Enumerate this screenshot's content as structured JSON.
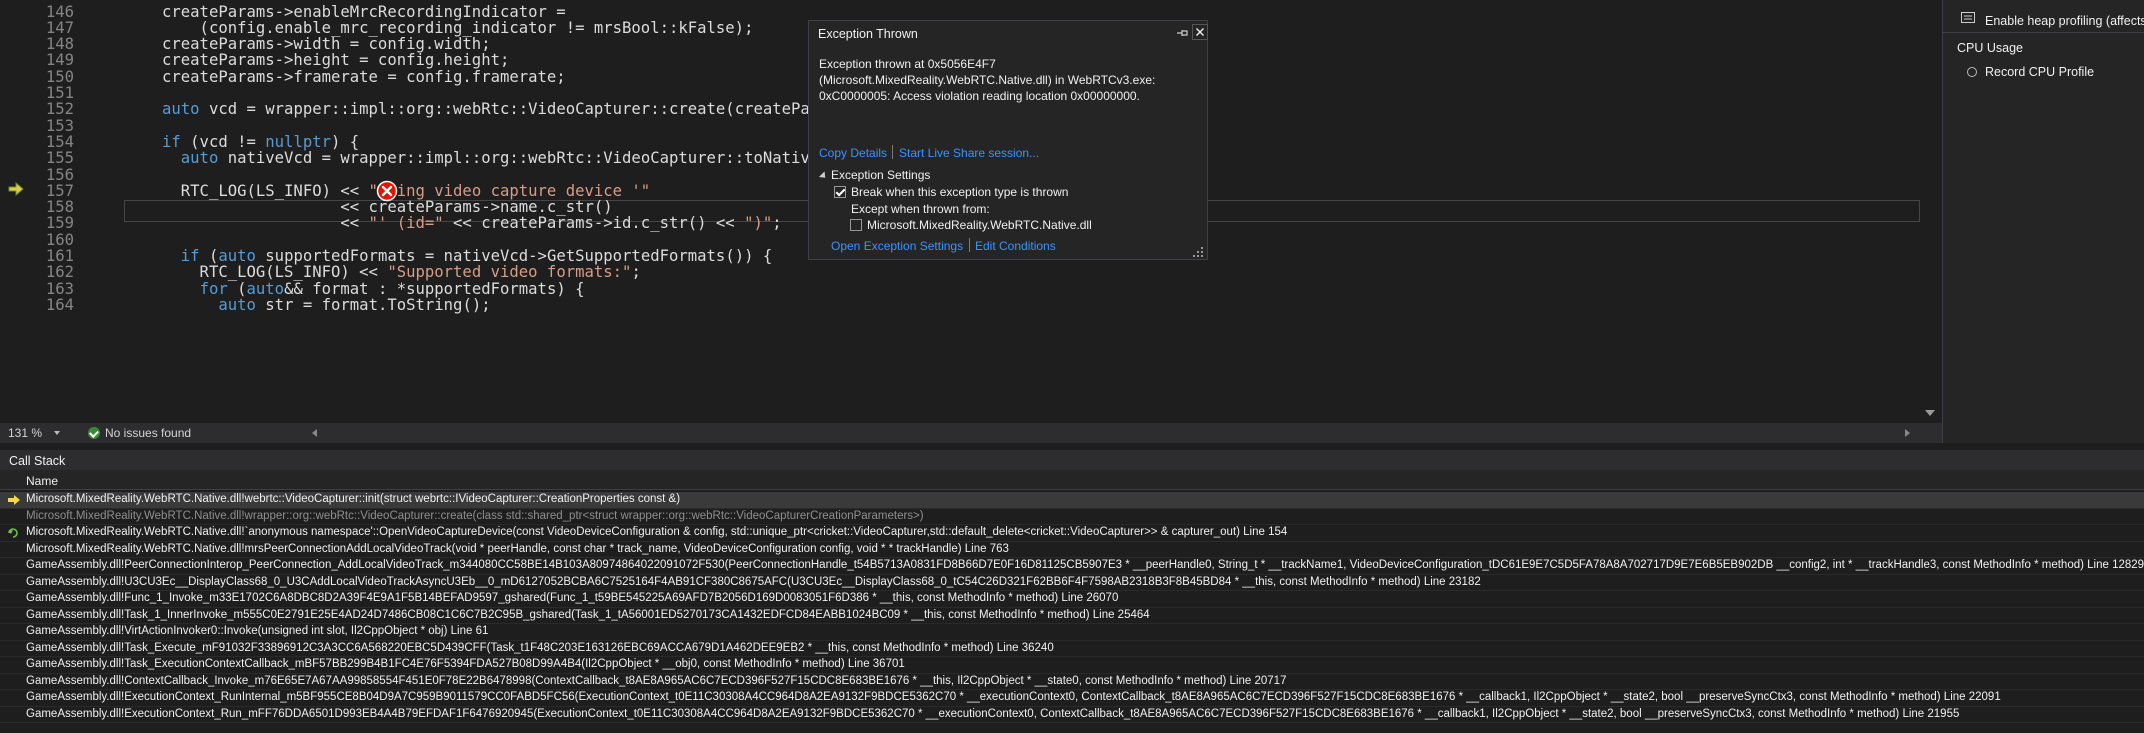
{
  "editor": {
    "lines": [
      {
        "num": "146",
        "code": "createParams->enableMrcRecordingIndicator ="
      },
      {
        "num": "147",
        "code": "    (config.enable_mrc_recording_indicator != mrsBool::kFalse);"
      },
      {
        "num": "148",
        "code": "createParams->width = config.width;"
      },
      {
        "num": "149",
        "code": "createParams->height = config.height;"
      },
      {
        "num": "150",
        "code": "createParams->framerate = config.framerate;"
      },
      {
        "num": "151",
        "code": ""
      },
      {
        "num": "152",
        "code": "auto vcd = wrapper::impl::org::webRtc::VideoCapturer::create(createPa"
      },
      {
        "num": "153",
        "code": ""
      },
      {
        "num": "154",
        "code": "if (vcd != nullptr) {"
      },
      {
        "num": "155",
        "code": "  auto nativeVcd = wrapper::impl::org::webRtc::VideoCapturer::toNativ"
      },
      {
        "num": "156",
        "code": ""
      },
      {
        "num": "157",
        "code": "  RTC_LOG(LS_INFO) << \"Using video capture device '\""
      },
      {
        "num": "158",
        "code": "                   << createParams->name.c_str()"
      },
      {
        "num": "159",
        "code": "                   << \"' (id=\" << createParams->id.c_str() << \")\";"
      },
      {
        "num": "160",
        "code": ""
      },
      {
        "num": "161",
        "code": "  if (auto supportedFormats = nativeVcd->GetSupportedFormats()) {"
      },
      {
        "num": "162",
        "code": "    RTC_LOG(LS_INFO) << \"Supported video formats:\";"
      },
      {
        "num": "163",
        "code": "    for (auto&& format : *supportedFormats) {"
      },
      {
        "num": "164",
        "code": "      auto str = format.ToString();"
      }
    ],
    "zoom": "131 %",
    "issues": "No issues found"
  },
  "exception": {
    "title": "Exception Thrown",
    "message": "Exception thrown at 0x5056E4F7\n(Microsoft.MixedReality.WebRTC.Native.dll) in WebRTCv3.exe:\n0xC0000005: Access violation reading location 0x00000000.",
    "copy_details": "Copy Details",
    "live_share": "Start Live Share session...",
    "settings_header": "Exception Settings",
    "break_label": "Break when this exception type is thrown",
    "break_checked": true,
    "except_label": "Except when thrown from:",
    "dll_label": "Microsoft.MixedReality.WebRTC.Native.dll",
    "dll_checked": false,
    "open_settings": "Open Exception Settings",
    "edit_conditions": "Edit Conditions"
  },
  "right_panel": {
    "heap_label": "Enable heap profiling (affects p",
    "cpu_header": "CPU Usage",
    "cpu_label": "Record CPU Profile"
  },
  "call_stack": {
    "title": "Call Stack",
    "column_name": "Name",
    "rows": [
      {
        "text": "Microsoft.MixedReality.WebRTC.Native.dll!webrtc::VideoCapturer::init(struct webrtc::IVideoCapturer::CreationProperties const &)",
        "marker": "current",
        "dim": false
      },
      {
        "text": "Microsoft.MixedReality.WebRTC.Native.dll!wrapper::org::webRtc::VideoCapturer::create(class std::shared_ptr<struct wrapper::org::webRtc::VideoCapturerCreationParameters>)",
        "marker": "",
        "dim": true
      },
      {
        "text": "Microsoft.MixedReality.WebRTC.Native.dll!`anonymous namespace'::OpenVideoCaptureDevice(const VideoDeviceConfiguration & config, std::unique_ptr<cricket::VideoCapturer,std::default_delete<cricket::VideoCapturer>> & capturer_out) Line 154",
        "marker": "return",
        "dim": false
      },
      {
        "text": "Microsoft.MixedReality.WebRTC.Native.dll!mrsPeerConnectionAddLocalVideoTrack(void * peerHandle, const char * track_name, VideoDeviceConfiguration config, void * * trackHandle) Line 763",
        "marker": "",
        "dim": false
      },
      {
        "text": "GameAssembly.dll!PeerConnectionInterop_PeerConnection_AddLocalVideoTrack_m344080CC58BE14B103A8097486402209107​2F530(PeerConnectionHandle_t54B5713A0831FD8B66D7E0F16D81125CB5907E3 * __peerHandle0, String_t * __trackName1, VideoDeviceConfiguration_tDC61E9E7C5D5FA78A8A702717D9E7E6B5EB902DB __config2, int * __trackHandle3, const MethodInfo * method) Line 12829",
        "marker": "",
        "dim": false
      },
      {
        "text": "GameAssembly.dll!U3CU3Ec__DisplayClass68_0_U3CAddLocalVideoTrackAsyncU3Eb__0_mD6127052BCBA6C7525164F4AB91CF380C8675AFC(U3CU3Ec__DisplayClass68_0_tC54C26D321F62BB6F4F7598AB2318B3F8B45BD84 * __this, const MethodInfo * method) Line 23182",
        "marker": "",
        "dim": false
      },
      {
        "text": "GameAssembly.dll!Func_1_Invoke_m33E1702C6A8DBC8D2A39F4E9A1F5B14BEFAD9597_gshared(Func_1_t59BE545225A69AFD7B2056D169D0083051F6D386 * __this, const MethodInfo * method) Line 26070",
        "marker": "",
        "dim": false
      },
      {
        "text": "GameAssembly.dll!Task_1_InnerInvoke_m555C0E2791E25E4AD24D7486CB08C1C6C7B2C95B_gshared(Task_1_tA56001ED5270173CA1432EDFCD84EABB1024BC09 * __this, const MethodInfo * method) Line 25464",
        "marker": "",
        "dim": false
      },
      {
        "text": "GameAssembly.dll!VirtActionInvoker0::Invoke(unsigned int slot, Il2CppObject * obj) Line 61",
        "marker": "",
        "dim": false
      },
      {
        "text": "GameAssembly.dll!Task_Execute_mF91032F33896912C3A3CC6A568220EBC5D439CFF(Task_t1F48C203E163126EBC69ACCA679D1A462DEE9EB2 * __this, const MethodInfo * method) Line 36240",
        "marker": "",
        "dim": false
      },
      {
        "text": "GameAssembly.dll!Task_ExecutionContextCallback_mBF57BB299B4B1FC4E76F5394FDA527B08D99A4B4(Il2CppObject * __obj0, const MethodInfo * method) Line 36701",
        "marker": "",
        "dim": false
      },
      {
        "text": "GameAssembly.dll!ContextCallback_Invoke_m76E65E7A67AA99858554F451E0F78E22B6478998(ContextCallback_t8AE8A965AC6C7ECD396F527F15CDC8E683BE1676 * __this, Il2CppObject * __state0, const MethodInfo * method) Line 20717",
        "marker": "",
        "dim": false
      },
      {
        "text": "GameAssembly.dll!ExecutionContext_RunInternal_m5BF955CE8B04D9A7C959B9011579CC0FABD5FC56(ExecutionContext_t0E11C30308A4CC964D8A2EA9132F9BDCE5362C70 * __executionContext0, ContextCallback_t8AE8A965AC6C7ECD396F527F15CDC8E683BE1676 * __callback1, Il2CppObject * __state2, bool __preserveSyncCtx3, const MethodInfo * method) Line 22091",
        "marker": "",
        "dim": false
      },
      {
        "text": "GameAssembly.dll!ExecutionContext_Run_mFF76DDA6501D993EB4A4B79EFDAF1F6476920945(ExecutionContext_t0E11C30308A4CC964D8A2EA9132F9BDCE5362C70 * __executionContext0, ContextCallback_t8AE8A965AC6C7ECD396F527F15CDC8E683BE1676 * __callback1, Il2CppObject * __state2, bool __preserveSyncCtx3, const MethodInfo * method) Line 21955",
        "marker": "",
        "dim": false
      }
    ]
  }
}
